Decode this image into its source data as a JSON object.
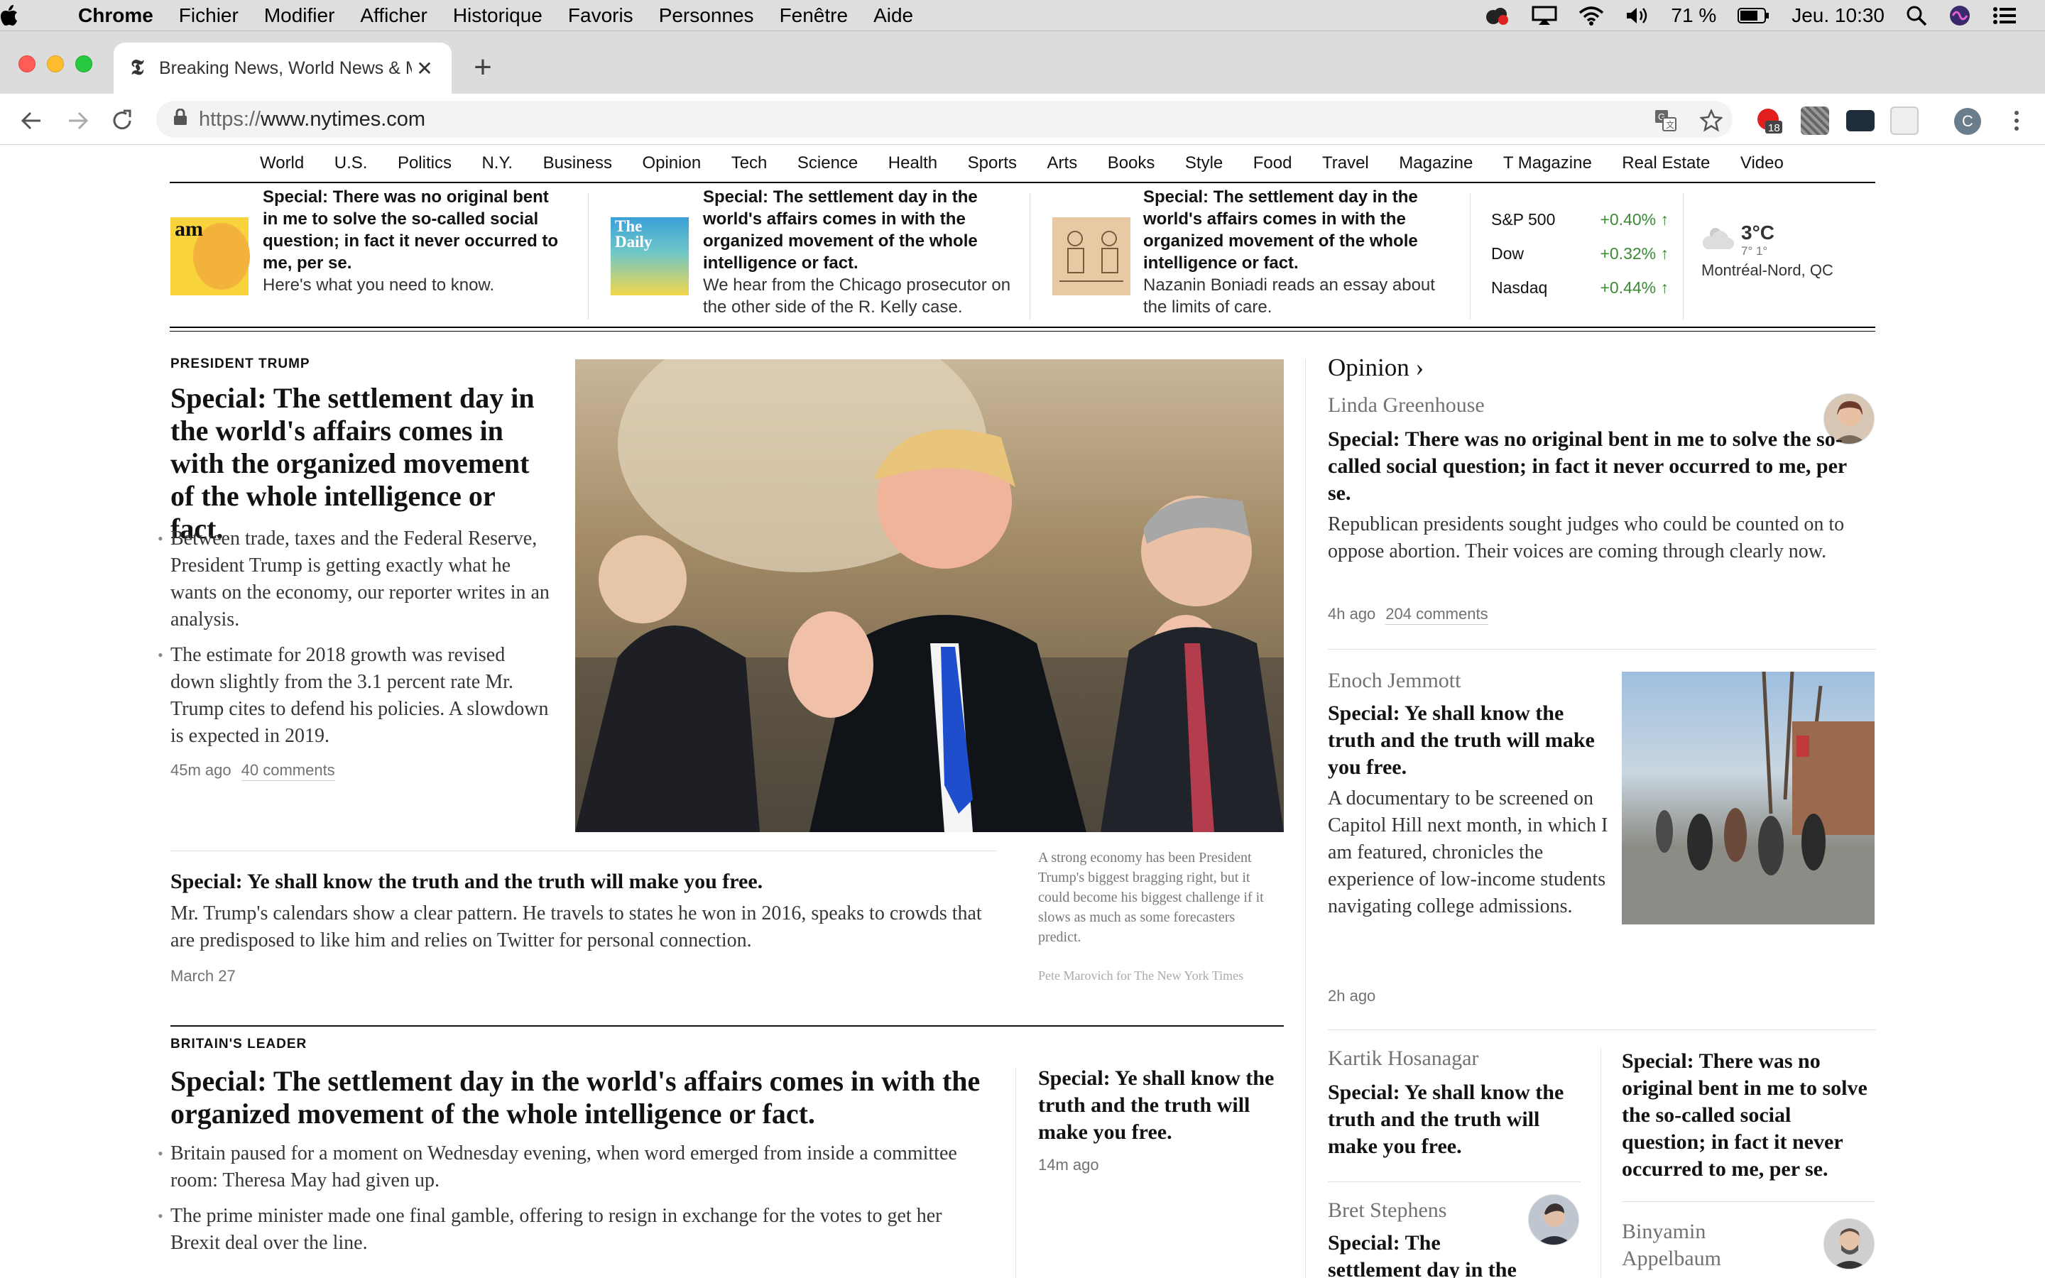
{
  "menubar": {
    "app": "Chrome",
    "items": [
      "Fichier",
      "Modifier",
      "Afficher",
      "Historique",
      "Favoris",
      "Personnes",
      "Fenêtre",
      "Aide"
    ],
    "battery": "71 %",
    "clock": "Jeu. 10:30"
  },
  "browser": {
    "tab_title": "Breaking News, World News & Multimedia",
    "url_scheme": "https://",
    "url_host": "www.nytimes.com",
    "ext_badge": "18",
    "profile_initial": "C"
  },
  "nav": [
    "World",
    "U.S.",
    "Politics",
    "N.Y.",
    "Business",
    "Opinion",
    "Tech",
    "Science",
    "Health",
    "Sports",
    "Arts",
    "Books",
    "Style",
    "Food",
    "Travel",
    "Magazine",
    "T Magazine",
    "Real Estate",
    "Video"
  ],
  "briefing": [
    {
      "thumb_text": "am",
      "headline": "Special: There was no original bent in me to solve the so-called social question; in fact it never occurred to me, per se.",
      "summary": "Here's what you need to know."
    },
    {
      "thumb_text": "The Daily",
      "headline": "Special: The settlement day in the world's affairs comes in with the organized movement of the whole intelligence or fact.",
      "summary": "We hear from the Chicago prosecutor on the other side of the R. Kelly case."
    },
    {
      "headline": "Special: The settlement day in the world's affairs comes in with the organized movement of the whole intelligence or fact.",
      "summary": "Nazanin Boniadi reads an essay about the limits of care."
    }
  ],
  "markets": [
    {
      "name": "S&P 500",
      "value": "+0.40%"
    },
    {
      "name": "Dow",
      "value": "+0.32%"
    },
    {
      "name": "Nasdaq",
      "value": "+0.44%"
    }
  ],
  "weather": {
    "temp": "3°C",
    "range": "7° 1°",
    "location": "Montréal-Nord, QC"
  },
  "lead": {
    "kicker": "PRESIDENT TRUMP",
    "headline": "Special: The settlement day in the world's affairs comes in with the organized movement of the whole intelligence or fact.",
    "bullets": [
      "Between trade, taxes and the Federal Reserve, President Trump is getting exactly what he wants on the economy, our reporter writes in an analysis.",
      "The estimate for 2018 growth was revised down slightly from the 3.1 percent rate Mr. Trump cites to defend his policies. A slowdown is expected in 2019."
    ],
    "time": "45m ago",
    "comments": "40 comments",
    "caption": "A strong economy has been President Trump's biggest bragging right, but it could become his biggest challenge if it slows as much as some forecasters predict.",
    "credit": "Pete Marovich for The New York Times"
  },
  "second": {
    "headline": "Special: Ye shall know the truth and the truth will make you free.",
    "summary": "Mr. Trump's calendars show a clear pattern. He travels to states he won in 2016, speaks to crowds that are predisposed to like him and relies on Twitter for personal connection.",
    "date": "March 27"
  },
  "britain": {
    "kicker": "BRITAIN'S LEADER",
    "headline": "Special: The settlement day in the world's affairs comes in with the organized movement of the whole intelligence or fact.",
    "bullets": [
      "Britain paused for a moment on Wednesday evening, when word emerged from inside a committee room: Theresa May had given up.",
      "The prime minister made one final gamble, offering to resign in exchange for the votes to get her Brexit deal over the line."
    ],
    "side_headline": "Special: Ye shall know the truth and the truth will make you free.",
    "side_time": "14m ago"
  },
  "opinion": {
    "title": "Opinion",
    "items": [
      {
        "author": "Linda Greenhouse",
        "headline": "Special: There was no original bent in me to solve the so-called social question; in fact it never occurred to me, per se.",
        "summary": "Republican presidents sought judges who could be counted on to oppose abortion. Their voices are coming through clearly now.",
        "time": "4h ago",
        "comments": "204 comments"
      },
      {
        "author": "Enoch Jemmott",
        "headline": "Special: Ye shall know the truth and the truth will make you free.",
        "summary": "A documentary to be screened on Capitol Hill next month, in which I am featured, chronicles the experience of low-income students navigating college admissions.",
        "time": "2h ago"
      },
      {
        "author": "Kartik Hosanagar",
        "headline": "Special: Ye shall know the truth and the truth will make you free."
      },
      {
        "headline": "Special: There was no original bent in me to solve the so-called social question; in fact it never occurred to me, per se."
      },
      {
        "author": "Bret Stephens",
        "headline": "Special: The settlement day in the"
      },
      {
        "author": "Binyamin Appelbaum"
      }
    ]
  },
  "colors": {
    "market_up": "#3c8a34",
    "traffic_red": "#fd5d55",
    "traffic_yellow": "#febc2e",
    "traffic_green": "#28c840"
  }
}
